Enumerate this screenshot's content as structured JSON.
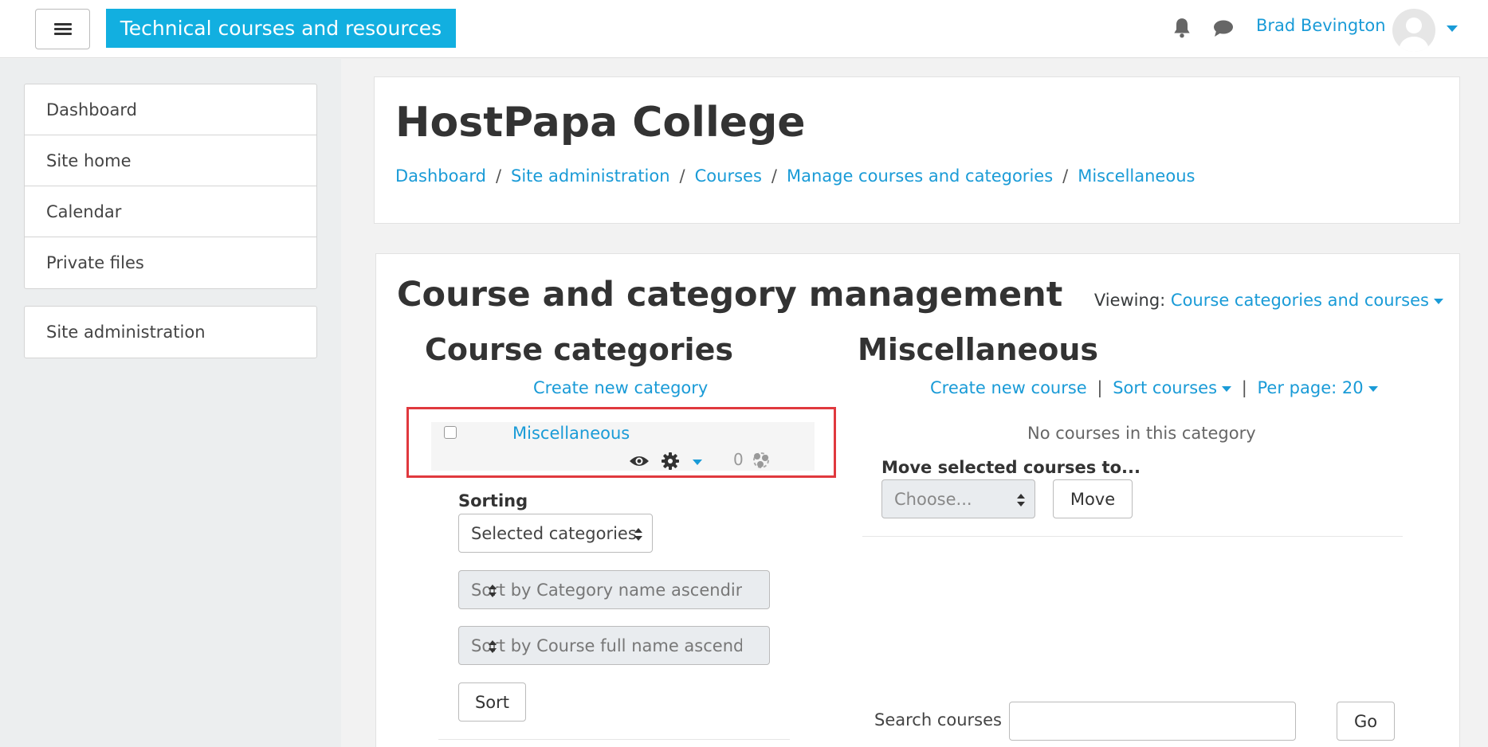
{
  "navbar": {
    "brand": "Technical courses and resources",
    "username": "Brad Bevington"
  },
  "drawer": {
    "items": [
      "Dashboard",
      "Site home",
      "Calendar",
      "Private files"
    ],
    "admin": "Site administration"
  },
  "header": {
    "title": "HostPapa College",
    "breadcrumb": [
      "Dashboard",
      "Site administration",
      "Courses",
      "Manage courses and categories",
      "Miscellaneous"
    ],
    "separator": "/"
  },
  "management": {
    "title": "Course and category management",
    "viewing_label": "Viewing:",
    "viewing_value": "Course categories and courses"
  },
  "categories": {
    "title": "Course categories",
    "create_link": "Create new category",
    "items": [
      {
        "name": "Miscellaneous",
        "count": "0"
      }
    ],
    "sorting_label": "Sorting",
    "sort_select": "Selected categories",
    "category_sort": "Sort by Category name ascending",
    "course_sort": "Sort by Course full name ascending",
    "sort_button": "Sort"
  },
  "courses": {
    "title": "Miscellaneous",
    "create_link": "Create new course",
    "sort_link": "Sort courses",
    "per_page": "Per page: 20",
    "pipe": "|",
    "empty_text": "No courses in this category",
    "move_label": "Move selected courses to...",
    "move_select": "Choose...",
    "move_button": "Move"
  },
  "search": {
    "label": "Search courses",
    "value": "",
    "button": "Go"
  },
  "colors": {
    "accent": "#1a9bd7",
    "brand_bg": "#12afe0",
    "highlight": "#e0393e"
  }
}
